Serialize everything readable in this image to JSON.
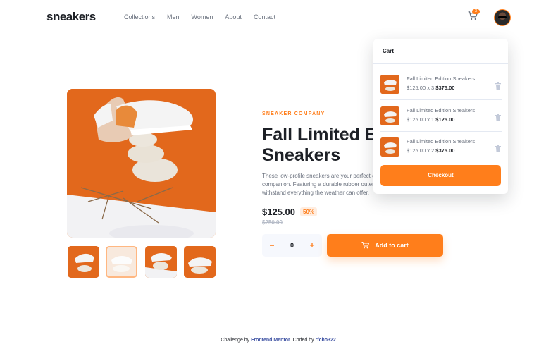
{
  "header": {
    "logo": "sneakers",
    "nav": [
      "Collections",
      "Men",
      "Women",
      "About",
      "Contact"
    ],
    "cart_count": "3"
  },
  "product": {
    "company": "SNEAKER COMPANY",
    "title": "Fall Limited Edition\nSneakers",
    "description": "These low-profile sneakers are your perfect casual wear\ncompanion. Featuring a durable rubber outer sole, they'll\nwithstand everything the weather can offer.",
    "price": "$125.00",
    "discount": "50%",
    "old_price": "$250.00",
    "quantity": "0",
    "minus": "−",
    "plus": "+",
    "add_to_cart": "Add to cart"
  },
  "gallery": {
    "thumb_count": 4,
    "active_thumb": 2
  },
  "cart": {
    "title": "Cart",
    "items": [
      {
        "name": "Fall Limited Edition Sneakers",
        "unit": "$125.00 x 3",
        "total": "$375.00"
      },
      {
        "name": "Fall Limited Edition Sneakers",
        "unit": "$125.00 x 1",
        "total": "$125.00"
      },
      {
        "name": "Fall Limited Edition Sneakers",
        "unit": "$125.00 x 2",
        "total": "$375.00"
      }
    ],
    "checkout": "Checkout"
  },
  "footer": {
    "prefix": "Challenge by ",
    "brand": "Frontend Mentor",
    "middle": ". Coded by ",
    "author": "rfcho322",
    "suffix": "."
  },
  "colors": {
    "accent": "#ff7e1b",
    "pale_accent": "#ffede0",
    "dark": "#1d2026"
  }
}
